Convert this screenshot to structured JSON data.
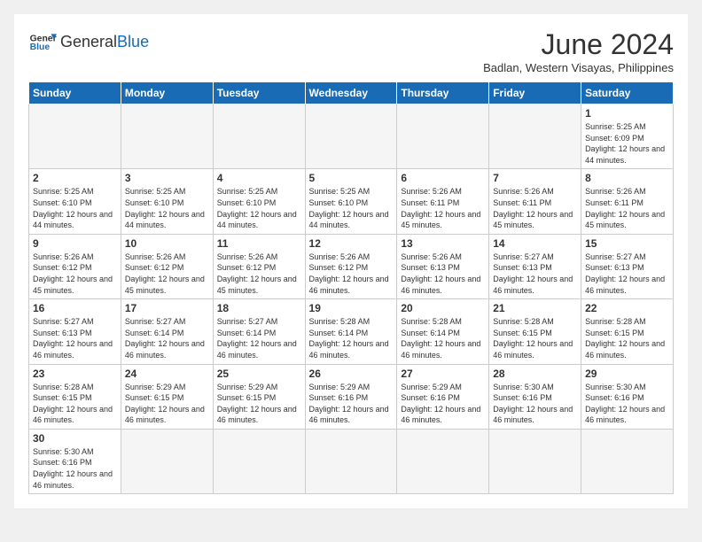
{
  "header": {
    "logo_general": "General",
    "logo_blue": "Blue",
    "title": "June 2024",
    "subtitle": "Badlan, Western Visayas, Philippines"
  },
  "days_of_week": [
    "Sunday",
    "Monday",
    "Tuesday",
    "Wednesday",
    "Thursday",
    "Friday",
    "Saturday"
  ],
  "weeks": [
    [
      {
        "day": "",
        "info": ""
      },
      {
        "day": "",
        "info": ""
      },
      {
        "day": "",
        "info": ""
      },
      {
        "day": "",
        "info": ""
      },
      {
        "day": "",
        "info": ""
      },
      {
        "day": "",
        "info": ""
      },
      {
        "day": "1",
        "info": "Sunrise: 5:25 AM\nSunset: 6:09 PM\nDaylight: 12 hours and 44 minutes."
      }
    ],
    [
      {
        "day": "2",
        "info": "Sunrise: 5:25 AM\nSunset: 6:10 PM\nDaylight: 12 hours and 44 minutes."
      },
      {
        "day": "3",
        "info": "Sunrise: 5:25 AM\nSunset: 6:10 PM\nDaylight: 12 hours and 44 minutes."
      },
      {
        "day": "4",
        "info": "Sunrise: 5:25 AM\nSunset: 6:10 PM\nDaylight: 12 hours and 44 minutes."
      },
      {
        "day": "5",
        "info": "Sunrise: 5:25 AM\nSunset: 6:10 PM\nDaylight: 12 hours and 44 minutes."
      },
      {
        "day": "6",
        "info": "Sunrise: 5:26 AM\nSunset: 6:11 PM\nDaylight: 12 hours and 45 minutes."
      },
      {
        "day": "7",
        "info": "Sunrise: 5:26 AM\nSunset: 6:11 PM\nDaylight: 12 hours and 45 minutes."
      },
      {
        "day": "8",
        "info": "Sunrise: 5:26 AM\nSunset: 6:11 PM\nDaylight: 12 hours and 45 minutes."
      }
    ],
    [
      {
        "day": "9",
        "info": "Sunrise: 5:26 AM\nSunset: 6:12 PM\nDaylight: 12 hours and 45 minutes."
      },
      {
        "day": "10",
        "info": "Sunrise: 5:26 AM\nSunset: 6:12 PM\nDaylight: 12 hours and 45 minutes."
      },
      {
        "day": "11",
        "info": "Sunrise: 5:26 AM\nSunset: 6:12 PM\nDaylight: 12 hours and 45 minutes."
      },
      {
        "day": "12",
        "info": "Sunrise: 5:26 AM\nSunset: 6:12 PM\nDaylight: 12 hours and 46 minutes."
      },
      {
        "day": "13",
        "info": "Sunrise: 5:26 AM\nSunset: 6:13 PM\nDaylight: 12 hours and 46 minutes."
      },
      {
        "day": "14",
        "info": "Sunrise: 5:27 AM\nSunset: 6:13 PM\nDaylight: 12 hours and 46 minutes."
      },
      {
        "day": "15",
        "info": "Sunrise: 5:27 AM\nSunset: 6:13 PM\nDaylight: 12 hours and 46 minutes."
      }
    ],
    [
      {
        "day": "16",
        "info": "Sunrise: 5:27 AM\nSunset: 6:13 PM\nDaylight: 12 hours and 46 minutes."
      },
      {
        "day": "17",
        "info": "Sunrise: 5:27 AM\nSunset: 6:14 PM\nDaylight: 12 hours and 46 minutes."
      },
      {
        "day": "18",
        "info": "Sunrise: 5:27 AM\nSunset: 6:14 PM\nDaylight: 12 hours and 46 minutes."
      },
      {
        "day": "19",
        "info": "Sunrise: 5:28 AM\nSunset: 6:14 PM\nDaylight: 12 hours and 46 minutes."
      },
      {
        "day": "20",
        "info": "Sunrise: 5:28 AM\nSunset: 6:14 PM\nDaylight: 12 hours and 46 minutes."
      },
      {
        "day": "21",
        "info": "Sunrise: 5:28 AM\nSunset: 6:15 PM\nDaylight: 12 hours and 46 minutes."
      },
      {
        "day": "22",
        "info": "Sunrise: 5:28 AM\nSunset: 6:15 PM\nDaylight: 12 hours and 46 minutes."
      }
    ],
    [
      {
        "day": "23",
        "info": "Sunrise: 5:28 AM\nSunset: 6:15 PM\nDaylight: 12 hours and 46 minutes."
      },
      {
        "day": "24",
        "info": "Sunrise: 5:29 AM\nSunset: 6:15 PM\nDaylight: 12 hours and 46 minutes."
      },
      {
        "day": "25",
        "info": "Sunrise: 5:29 AM\nSunset: 6:15 PM\nDaylight: 12 hours and 46 minutes."
      },
      {
        "day": "26",
        "info": "Sunrise: 5:29 AM\nSunset: 6:16 PM\nDaylight: 12 hours and 46 minutes."
      },
      {
        "day": "27",
        "info": "Sunrise: 5:29 AM\nSunset: 6:16 PM\nDaylight: 12 hours and 46 minutes."
      },
      {
        "day": "28",
        "info": "Sunrise: 5:30 AM\nSunset: 6:16 PM\nDaylight: 12 hours and 46 minutes."
      },
      {
        "day": "29",
        "info": "Sunrise: 5:30 AM\nSunset: 6:16 PM\nDaylight: 12 hours and 46 minutes."
      }
    ],
    [
      {
        "day": "30",
        "info": "Sunrise: 5:30 AM\nSunset: 6:16 PM\nDaylight: 12 hours and 46 minutes."
      },
      {
        "day": "",
        "info": ""
      },
      {
        "day": "",
        "info": ""
      },
      {
        "day": "",
        "info": ""
      },
      {
        "day": "",
        "info": ""
      },
      {
        "day": "",
        "info": ""
      },
      {
        "day": "",
        "info": ""
      }
    ]
  ]
}
